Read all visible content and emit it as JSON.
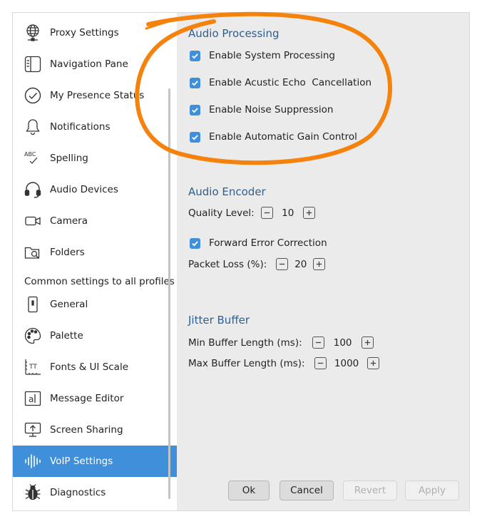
{
  "sidebar": {
    "items": [
      {
        "label": "Proxy Settings",
        "icon": "globe-network-icon"
      },
      {
        "label": "Navigation Pane",
        "icon": "navigation-pane-icon"
      },
      {
        "label": "My Presence Status",
        "icon": "check-circle-icon"
      },
      {
        "label": "Notifications",
        "icon": "bell-icon"
      },
      {
        "label": "Spelling",
        "icon": "spelling-icon"
      },
      {
        "label": "Audio Devices",
        "icon": "headset-icon"
      },
      {
        "label": "Camera",
        "icon": "camera-icon"
      },
      {
        "label": "Folders",
        "icon": "folder-search-icon"
      }
    ],
    "common_label": "Common settings to all profiles",
    "common_items": [
      {
        "label": "General",
        "icon": "general-icon"
      },
      {
        "label": "Palette",
        "icon": "palette-icon"
      },
      {
        "label": "Fonts & UI Scale",
        "icon": "fonts-scale-icon"
      },
      {
        "label": "Message Editor",
        "icon": "message-editor-icon"
      },
      {
        "label": "Screen Sharing",
        "icon": "screen-sharing-icon"
      },
      {
        "label": "VoIP Settings",
        "icon": "voip-waveform-icon",
        "active": true
      },
      {
        "label": "Diagnostics",
        "icon": "bug-icon"
      }
    ]
  },
  "audio_processing": {
    "title": "Audio Processing",
    "options": [
      {
        "label": "Enable System Processing",
        "checked": true
      },
      {
        "label": "Enable Acustic Echo  Cancellation",
        "checked": true
      },
      {
        "label": "Enable Noise Suppression",
        "checked": true
      },
      {
        "label": "Enable Automatic Gain Control",
        "checked": true
      }
    ]
  },
  "audio_encoder": {
    "title": "Audio Encoder",
    "quality_label": "Quality Level:",
    "quality_value": "10",
    "fec_label": "Forward Error Correction",
    "fec_checked": true,
    "packet_loss_label": "Packet Loss (%):",
    "packet_loss_value": "20"
  },
  "jitter_buffer": {
    "title": "Jitter Buffer",
    "min_label": "Min Buffer Length (ms):",
    "min_value": "100",
    "max_label": "Max Buffer Length (ms):",
    "max_value": "1000"
  },
  "buttons": {
    "ok": "Ok",
    "cancel": "Cancel",
    "revert": "Revert",
    "apply": "Apply"
  },
  "colors": {
    "accent": "#3f8fdb",
    "heading": "#2f5f8f",
    "annotation": "#f5820d"
  }
}
